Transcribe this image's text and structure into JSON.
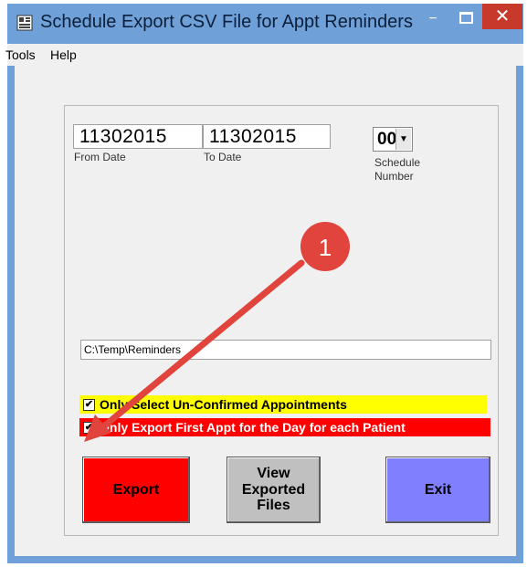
{
  "window": {
    "title": "Schedule Export CSV File for Appt Reminders",
    "min_glyph": "−",
    "close_glyph": "✕"
  },
  "menu": {
    "items": [
      "Tools",
      "Help"
    ]
  },
  "form": {
    "from_date": {
      "value": "11302015",
      "label": "From Date"
    },
    "to_date": {
      "value": "11302015",
      "label": "To Date"
    },
    "schedule": {
      "value": "00",
      "label_line1": "Schedule",
      "label_line2": "Number",
      "arrow": "▼"
    },
    "export_path": "C:\\Temp\\Reminders",
    "checkboxes": [
      {
        "label": "Only Select Un-Confirmed Appointments",
        "checked": true,
        "mark": "✔",
        "bg": "#ffff00",
        "fg": "#000000"
      },
      {
        "label": "Only Export First Appt for the Day for each Patient",
        "checked": true,
        "mark": "✔",
        "bg": "#ff0000",
        "fg": "#ffffff"
      }
    ],
    "buttons": {
      "export": "Export",
      "view_line1": "View",
      "view_line2": "Exported",
      "view_line3": "Files",
      "exit": "Exit"
    }
  },
  "annotation": {
    "number": "1"
  },
  "colors": {
    "titlebar": "#6fa0d8",
    "export_btn": "#ff0000",
    "view_btn": "#c0c0c0",
    "exit_btn": "#8080ff",
    "callout": "#e0443c"
  }
}
